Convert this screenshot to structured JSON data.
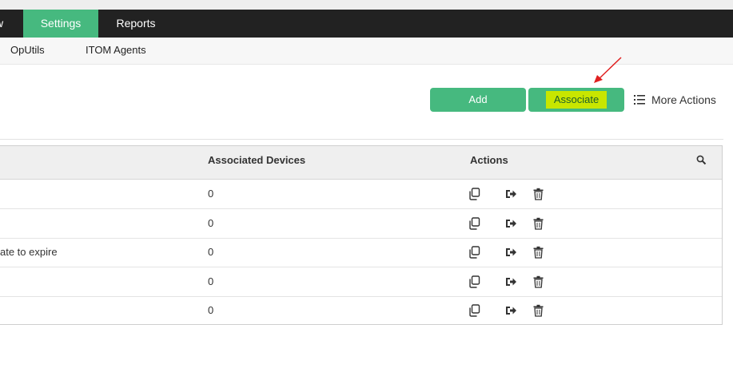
{
  "nav": {
    "tabs": [
      {
        "label": "w"
      },
      {
        "label": "Settings",
        "active": true
      },
      {
        "label": "Reports"
      }
    ]
  },
  "subnav": {
    "items": [
      {
        "label": "OpUtils"
      },
      {
        "label": "ITOM Agents"
      }
    ]
  },
  "toolbar": {
    "add_label": "Add",
    "associate_label": "Associate",
    "more_actions_label": "More Actions"
  },
  "table": {
    "columns": [
      "",
      "Associated Devices",
      "Actions"
    ],
    "rows": [
      {
        "name": "",
        "devices": "0"
      },
      {
        "name": "",
        "devices": "0"
      },
      {
        "name": "ate to expire",
        "devices": "0"
      },
      {
        "name": "",
        "devices": "0"
      },
      {
        "name": "",
        "devices": "0"
      }
    ],
    "row_actions": [
      "copy-icon",
      "move-icon",
      "trash-icon"
    ]
  },
  "colors": {
    "accent": "#46b97f",
    "nav_bg": "#222222",
    "highlight": "#c8e600",
    "annotation_arrow": "#e02020"
  }
}
